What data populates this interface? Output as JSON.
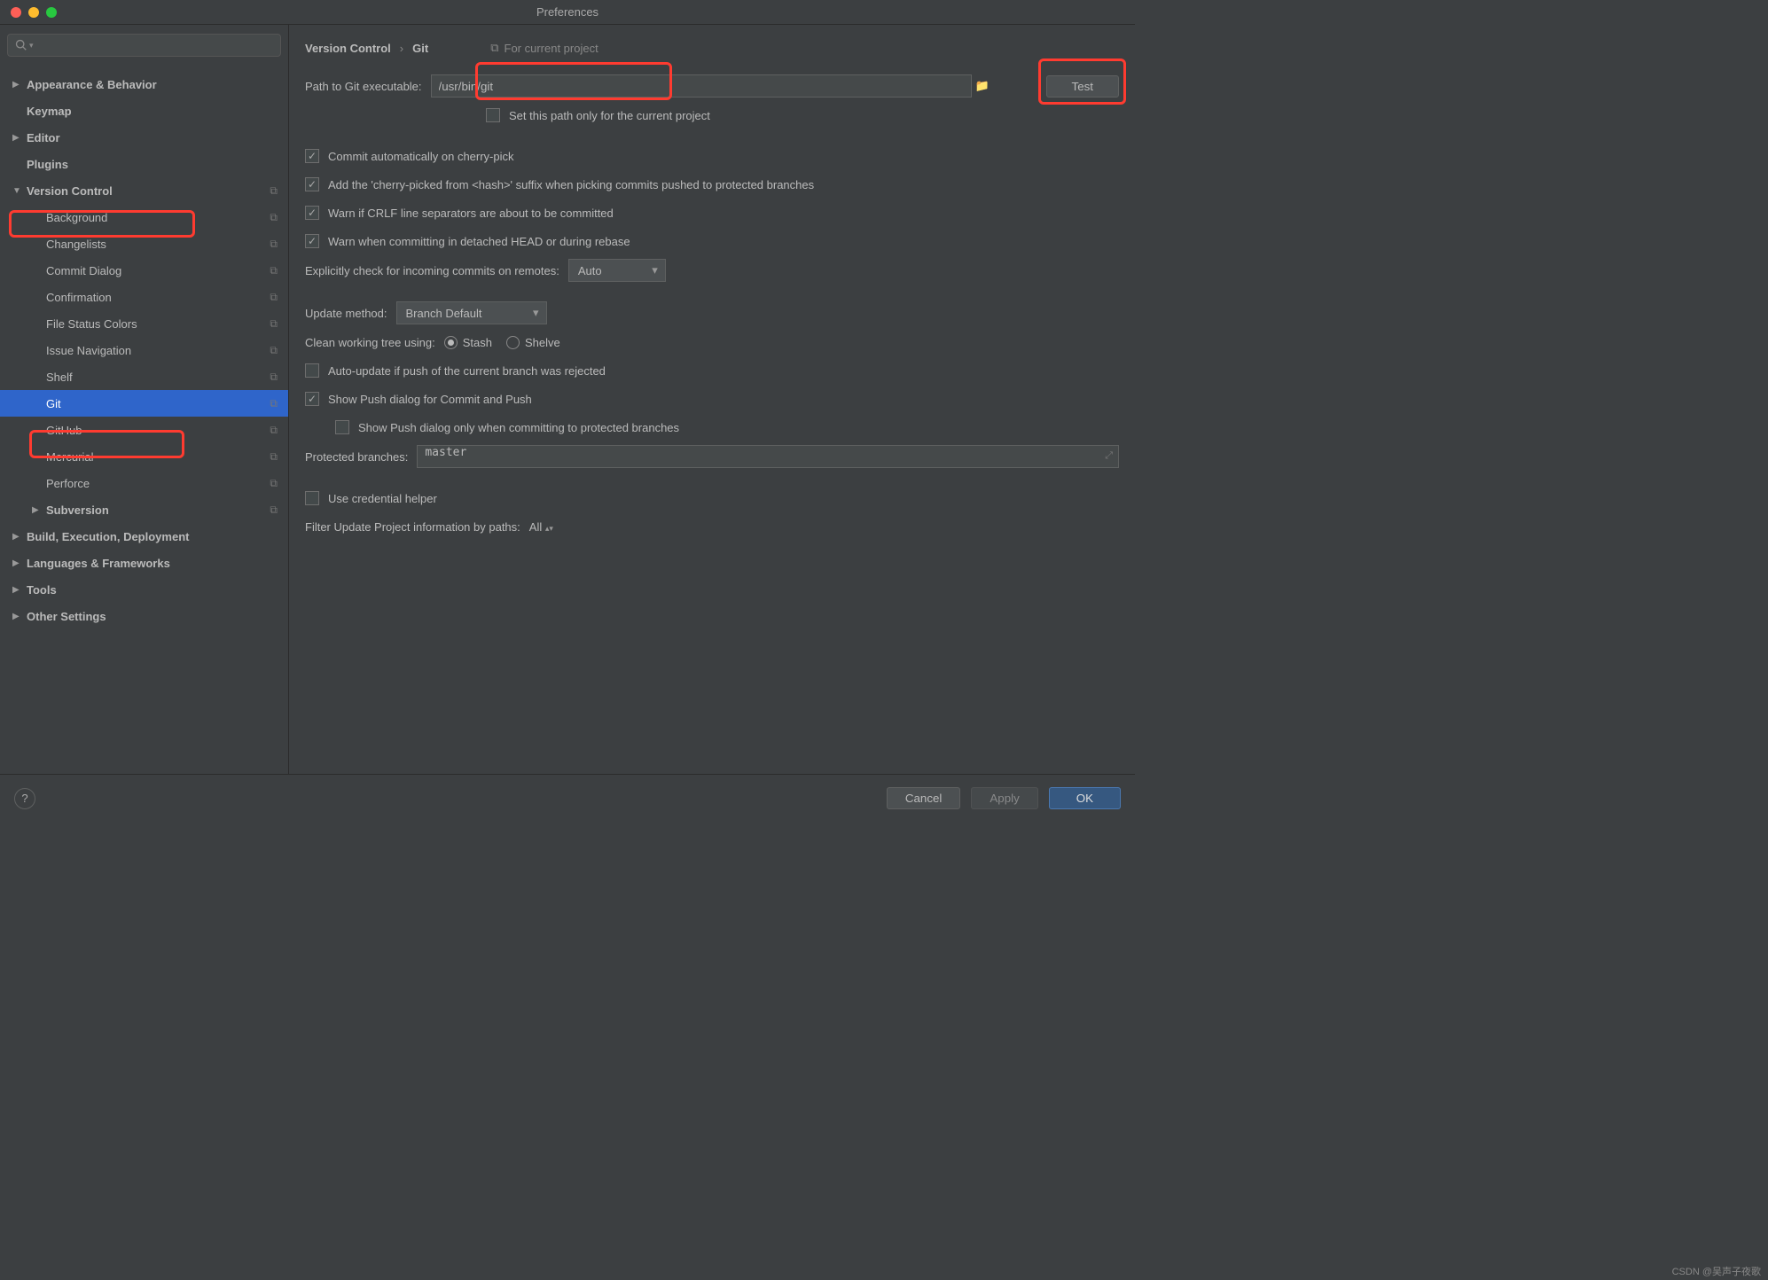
{
  "window": {
    "title": "Preferences"
  },
  "sidebar": {
    "search_placeholder": "",
    "items": [
      {
        "label": "Appearance & Behavior",
        "expandable": true
      },
      {
        "label": "Keymap"
      },
      {
        "label": "Editor",
        "expandable": true
      },
      {
        "label": "Plugins"
      },
      {
        "label": "Version Control",
        "expandable": true,
        "expanded": true,
        "copy": true,
        "children": [
          {
            "label": "Background",
            "copy": true
          },
          {
            "label": "Changelists",
            "copy": true
          },
          {
            "label": "Commit Dialog",
            "copy": true
          },
          {
            "label": "Confirmation",
            "copy": true
          },
          {
            "label": "File Status Colors",
            "copy": true
          },
          {
            "label": "Issue Navigation",
            "copy": true
          },
          {
            "label": "Shelf",
            "copy": true
          },
          {
            "label": "Git",
            "copy": true,
            "selected": true
          },
          {
            "label": "GitHub",
            "copy": true
          },
          {
            "label": "Mercurial",
            "copy": true
          },
          {
            "label": "Perforce",
            "copy": true
          }
        ]
      },
      {
        "label": "Subversion",
        "expandable": true,
        "copy": true,
        "indent": true
      },
      {
        "label": "Build, Execution, Deployment",
        "expandable": true
      },
      {
        "label": "Languages & Frameworks",
        "expandable": true
      },
      {
        "label": "Tools",
        "expandable": true
      },
      {
        "label": "Other Settings",
        "expandable": true
      }
    ]
  },
  "breadcrumb": {
    "a": "Version Control",
    "b": "Git",
    "tag": "For current project"
  },
  "git": {
    "path_label": "Path to Git executable:",
    "path_value": "/usr/bin/git",
    "test_label": "Test",
    "set_path_project": "Set this path only for the current project",
    "cb_commit_auto": "Commit automatically on cherry-pick",
    "cb_suffix": "Add the 'cherry-picked from <hash>' suffix when picking commits pushed to protected branches",
    "cb_crlf": "Warn if CRLF line separators are about to be committed",
    "cb_detached": "Warn when committing in detached HEAD or during rebase",
    "explicit_label": "Explicitly check for incoming commits on remotes:",
    "explicit_value": "Auto",
    "update_method_label": "Update method:",
    "update_method_value": "Branch Default",
    "clean_label": "Clean working tree using:",
    "clean_stash": "Stash",
    "clean_shelve": "Shelve",
    "cb_autoupdate": "Auto-update if push of the current branch was rejected",
    "cb_show_push": "Show Push dialog for Commit and Push",
    "cb_show_push_protected": "Show Push dialog only when committing to protected branches",
    "protected_label": "Protected branches:",
    "protected_value": "master",
    "cb_cred_helper": "Use credential helper",
    "filter_label": "Filter Update Project information by paths:",
    "filter_value": "All"
  },
  "footer": {
    "cancel": "Cancel",
    "apply": "Apply",
    "ok": "OK"
  },
  "watermark": "CSDN @吴声子夜歌"
}
